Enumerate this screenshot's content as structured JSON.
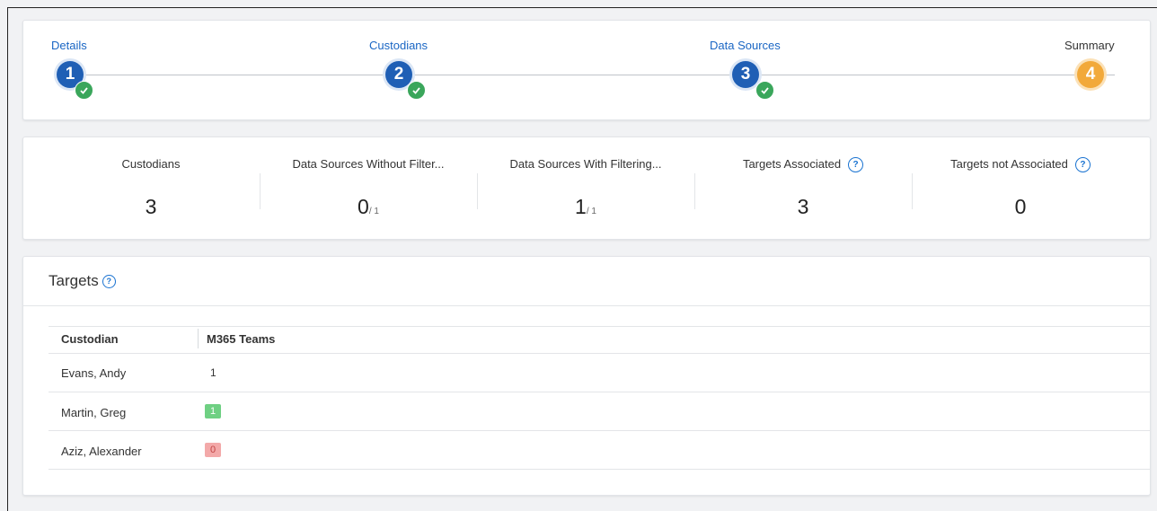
{
  "stepper": {
    "steps": [
      {
        "label": "Details",
        "number": "1",
        "status": "done"
      },
      {
        "label": "Custodians",
        "number": "2",
        "status": "done"
      },
      {
        "label": "Data Sources",
        "number": "3",
        "status": "done"
      },
      {
        "label": "Summary",
        "number": "4",
        "status": "pending"
      }
    ]
  },
  "stats": [
    {
      "label": "Custodians",
      "value": "3",
      "denominator": ""
    },
    {
      "label": "Data Sources Without Filter...",
      "value": "0",
      "denominator": "/ 1"
    },
    {
      "label": "Data Sources With Filtering...",
      "value": "1",
      "denominator": "/ 1"
    },
    {
      "label": "Targets Associated",
      "value": "3",
      "denominator": "",
      "help": "?"
    },
    {
      "label": "Targets not Associated",
      "value": "0",
      "denominator": "",
      "help": "?"
    }
  ],
  "targets": {
    "title": "Targets",
    "help": "?",
    "columns": [
      "Custodian",
      "M365 Teams"
    ],
    "rows": [
      {
        "custodian": "Evans, Andy",
        "value": "1",
        "status": "neutral"
      },
      {
        "custodian": "Martin, Greg",
        "value": "1",
        "status": "success"
      },
      {
        "custodian": "Aziz, Alexander",
        "value": "0",
        "status": "error"
      }
    ]
  },
  "colors": {
    "step_done": "#1f5fb5",
    "step_pending": "#f2a93a",
    "check": "#3aa65b",
    "link_blue": "#1a66c4",
    "badge_success": "#6fd083",
    "badge_error": "#f3a9a9"
  }
}
